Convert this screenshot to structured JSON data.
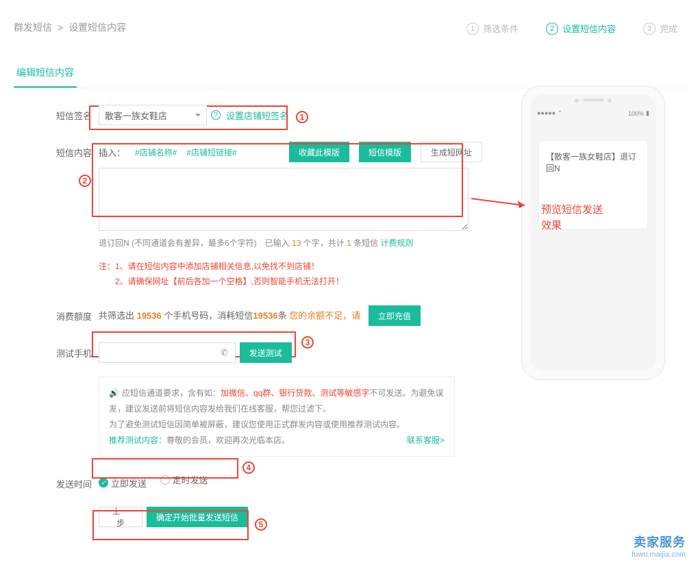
{
  "breadcrumb": {
    "parent": "群发短信",
    "sep": ">",
    "current": "设置短信内容"
  },
  "steps": [
    {
      "num": "①",
      "label": "筛选条件"
    },
    {
      "num": "②",
      "label": "设置短信内容"
    },
    {
      "num": "③",
      "label": "完成"
    }
  ],
  "tab": "编辑短信内容",
  "labels": {
    "sign": "短信签名",
    "content": "短信内容",
    "quota": "消费额度",
    "testPhone": "测试手机",
    "sendTime": "发送时间"
  },
  "sign": {
    "selected": "散客一族女鞋店",
    "setLink": "设置店铺短签名"
  },
  "insert": {
    "prefix": "插入：",
    "tag1": "#店铺名称#",
    "tag2": "#店铺短链接#"
  },
  "buttons": {
    "favTpl": "收藏此模版",
    "smsTpl": "短信模版",
    "shortUrl": "生成短网址",
    "recharge": "立即充值",
    "sendTest": "发送测试",
    "prev": "上一步",
    "confirm": "确定开始批量发送短信"
  },
  "counter": {
    "prefix": "退订回N (不同通道会有差异，最多6个字符)　已输入 ",
    "chars": "13",
    "mid": " 个字，共计 ",
    "msgs": "1",
    "suffix": " 条短信 ",
    "ruleLink": "计费规则"
  },
  "note": {
    "line1": "注：1、请在短信内容中添加店铺相关信息,以免找不到店铺！",
    "line2": "　　2、请确保网址【前后各加一个空格】,否则智能手机无法打开！"
  },
  "quota": {
    "p1": "共筛选出 ",
    "n1": "19536",
    "p2": " 个手机号码，消耗短信",
    "n2": "19536",
    "p3": "条 ",
    "warn": "您的余额不足，请"
  },
  "tip": {
    "l1a": "应短信通道要求，含有如：",
    "l1b": "加微信、qq群、银行贷款、测试等敏感字",
    "l1c": "不可发送。为避免误发，建议发送前将短信内容发给我们在线客服，帮您过滤下。",
    "l2": "为了避免测试短信因简单被屏蔽，建议您使用正式群发内容或使用推荐测试内容。",
    "l3a": "推荐测试内容：",
    "l3b": "尊敬的会员，欢迎再次光临本店。",
    "contact": "联系客服>"
  },
  "radios": {
    "now": "立即发送",
    "timed": "定时发送"
  },
  "preview": {
    "sms": "【散客一族女鞋店】退订回N",
    "statusLeft": "●●●●● ⌃",
    "statusRight": "100%",
    "annotation": "预览短信发送\n效果"
  },
  "watermark": {
    "big": "卖家服务",
    "small": "fuwu.maijia.com"
  }
}
